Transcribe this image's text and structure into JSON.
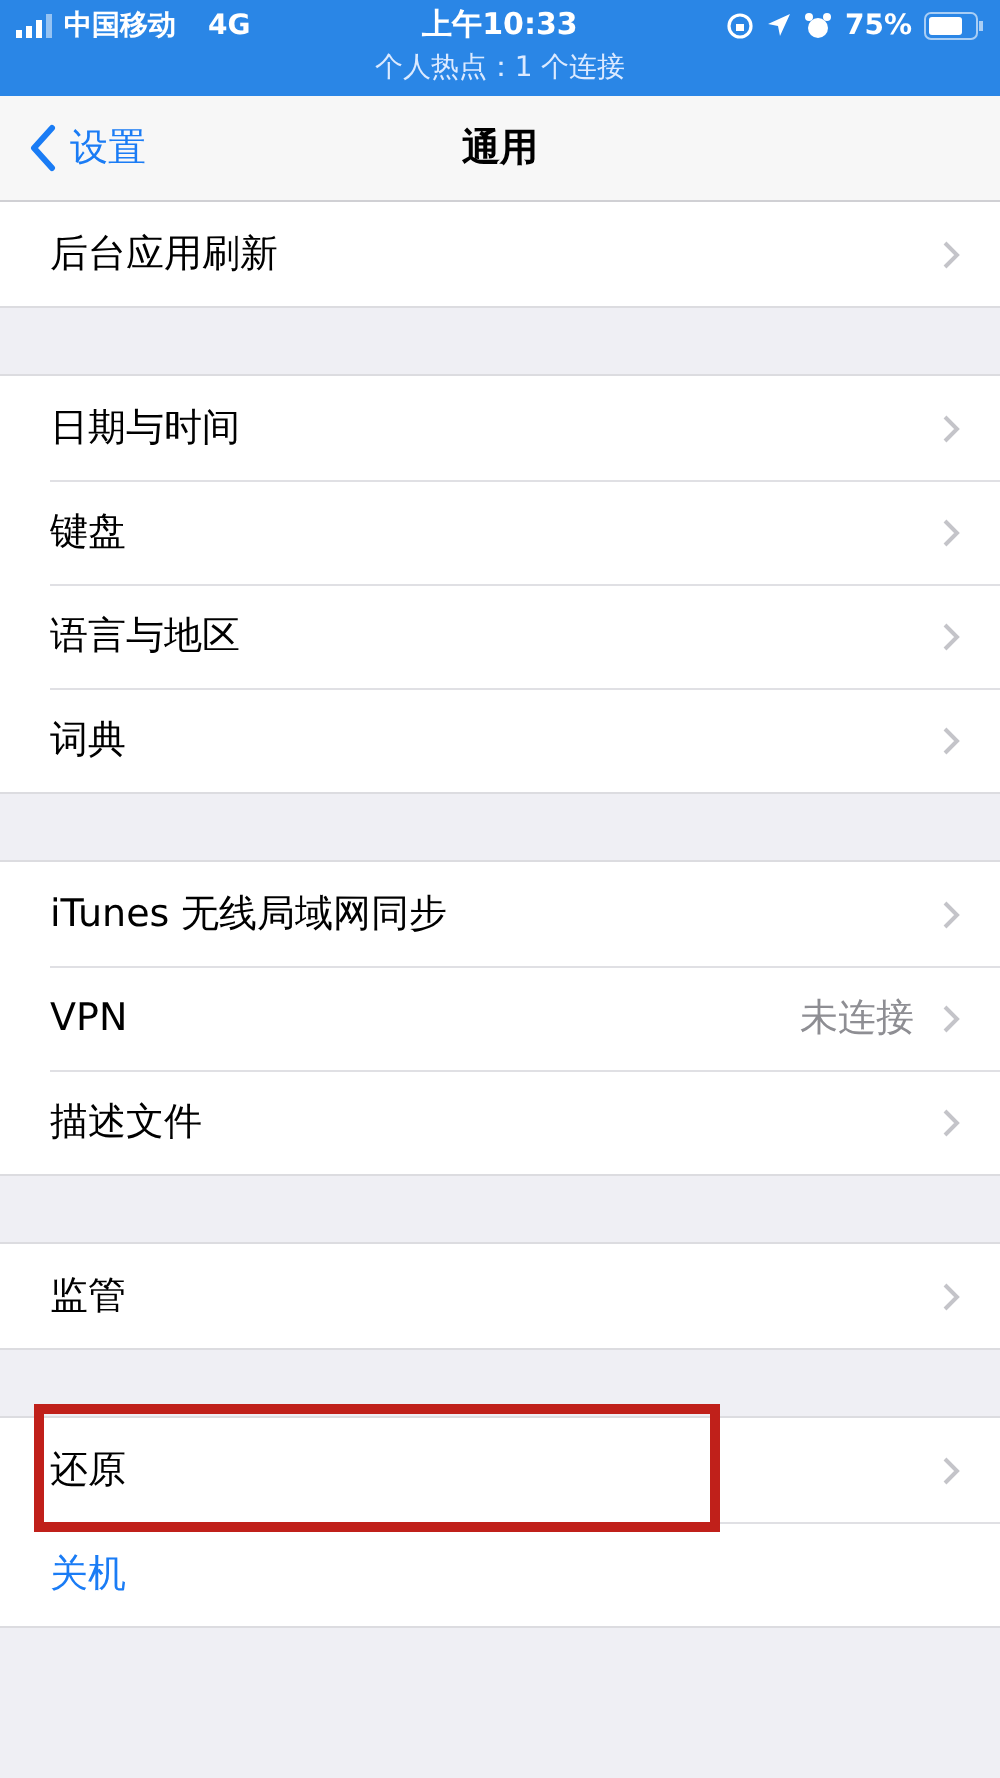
{
  "status_bar": {
    "carrier": "中国移动",
    "network": "4G",
    "time": "上午10:33",
    "battery": "75%",
    "hotspot": "个人热点：1 个连接"
  },
  "nav": {
    "back": "设置",
    "title": "通用"
  },
  "groups": [
    {
      "rows": [
        {
          "kind": "link",
          "label": "后台应用刷新",
          "highlighted": false
        }
      ]
    },
    {
      "rows": [
        {
          "kind": "link",
          "label": "日期与时间",
          "highlighted": false
        },
        {
          "kind": "link",
          "label": "键盘",
          "highlighted": false
        },
        {
          "kind": "link",
          "label": "语言与地区",
          "highlighted": false
        },
        {
          "kind": "link",
          "label": "词典",
          "highlighted": false
        }
      ]
    },
    {
      "rows": [
        {
          "kind": "link",
          "label": "iTunes 无线局域网同步",
          "highlighted": false
        },
        {
          "kind": "link",
          "label": "VPN",
          "detail": "未连接",
          "highlighted": false
        },
        {
          "kind": "link",
          "label": "描述文件",
          "highlighted": false
        }
      ]
    },
    {
      "rows": [
        {
          "kind": "link",
          "label": "监管",
          "highlighted": false
        }
      ]
    },
    {
      "rows": [
        {
          "kind": "link",
          "label": "还原",
          "highlighted": true
        },
        {
          "kind": "action",
          "label": "关机",
          "highlighted": false
        }
      ]
    }
  ]
}
